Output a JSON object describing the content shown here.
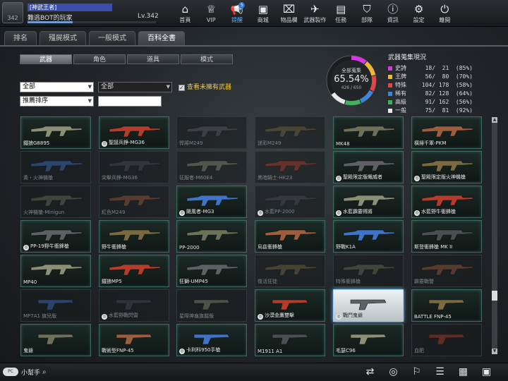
{
  "player": {
    "avatar_label": "342",
    "title": "[神武王者]",
    "nickname": "難逃BOT的玩家",
    "level": "Lv.342",
    "exp_fraction": 0.35
  },
  "nav": [
    {
      "label": "首頁",
      "icon": "home-icon",
      "glyph": "⌂"
    },
    {
      "label": "VIP",
      "icon": "vip-crown-icon",
      "glyph": "♕"
    },
    {
      "label": "提醒",
      "icon": "megaphone-icon",
      "glyph": "📢",
      "badge": "5"
    },
    {
      "label": "商城",
      "icon": "shop-icon",
      "glyph": "▣"
    },
    {
      "label": "物品欄",
      "icon": "backpack-icon",
      "glyph": "⌧"
    },
    {
      "label": "武器製作",
      "icon": "weapon-craft-icon",
      "glyph": "✈"
    },
    {
      "label": "任務",
      "icon": "ticket-icon",
      "glyph": "▤"
    },
    {
      "label": "部隊",
      "icon": "shield-icon",
      "glyph": "⛉"
    },
    {
      "label": "資訊",
      "icon": "info-icon",
      "glyph": "ⓘ"
    },
    {
      "label": "設定",
      "icon": "gear-icon",
      "glyph": "⚙"
    },
    {
      "label": "離開",
      "icon": "power-icon",
      "glyph": "⏻"
    }
  ],
  "tabs": [
    "排名",
    "殭屍模式",
    "一般模式",
    "百科全書"
  ],
  "active_tab": 3,
  "subtabs": [
    "武器",
    "角色",
    "道具",
    "模式"
  ],
  "active_subtab": 0,
  "filters": {
    "filter1": "全部",
    "filter2": "全部",
    "sort": "推薦排序",
    "show_unowned": "查看未擁有武器",
    "search_value": ""
  },
  "collection": {
    "label": "全部蒐集",
    "percent": "65.54%",
    "count": "426 / 650",
    "fraction": 0.6554,
    "stats_title": "武器蒐集現況",
    "rows": [
      {
        "name": "史詩",
        "value": "18/  21  (85%)",
        "color": "#d23adf"
      },
      {
        "name": "王牌",
        "value": "56/  80  (70%)",
        "color": "#f0b63a"
      },
      {
        "name": "特殊",
        "value": "104/ 178  (58%)",
        "color": "#e24545"
      },
      {
        "name": "稀有",
        "value": "82/ 128  (64%)",
        "color": "#3f86d8"
      },
      {
        "name": "高級",
        "value": "91/ 162  (56%)",
        "color": "#3fb25a"
      },
      {
        "name": "一般",
        "value": "75/  81  (92%)",
        "color": "#e8e8e8"
      }
    ]
  },
  "weapons": [
    {
      "name": "鐵狼G8895",
      "owned": true,
      "mark": false
    },
    {
      "name": "聖誕兵錚-MG36",
      "owned": true,
      "mark": true
    },
    {
      "name": "悍將M249",
      "owned": false,
      "mark": false
    },
    {
      "name": "迷彩M249",
      "owned": false,
      "mark": false
    },
    {
      "name": "MK48",
      "owned": true,
      "mark": false
    },
    {
      "name": "橫掃千軍-PKM",
      "owned": true,
      "mark": false
    },
    {
      "name": "黃・火神機槍",
      "owned": false,
      "mark": false
    },
    {
      "name": "突擊兵錚-MG36",
      "owned": false,
      "mark": false
    },
    {
      "name": "征服者-M60E4",
      "owned": false,
      "mark": false
    },
    {
      "name": "黑暗騎士-HK23",
      "owned": false,
      "mark": false
    },
    {
      "name": "聖殿限定版飆威者",
      "owned": true,
      "mark": true
    },
    {
      "name": "聖殿限定版火神機槍",
      "owned": true,
      "mark": true
    },
    {
      "name": "火神機槍-Minigun",
      "owned": false,
      "mark": false
    },
    {
      "name": "紅色M249",
      "owned": false,
      "mark": false
    },
    {
      "name": "颶風者-MG3",
      "owned": true,
      "mark": true
    },
    {
      "name": "水藍PP-2000",
      "owned": false,
      "mark": true
    },
    {
      "name": "水藍霹靂得將",
      "owned": true,
      "mark": true
    },
    {
      "name": "水藍野牛衝鋒槍",
      "owned": true,
      "mark": true
    },
    {
      "name": "PP-19野牛衝鋒槍",
      "owned": true,
      "mark": true
    },
    {
      "name": "野牛衝鋒槍",
      "owned": true,
      "mark": false
    },
    {
      "name": "PP-2000",
      "owned": true,
      "mark": false
    },
    {
      "name": "烏茲衝鋒槍",
      "owned": true,
      "mark": false
    },
    {
      "name": "野戰K1A",
      "owned": true,
      "mark": false
    },
    {
      "name": "斯登衝鋒槍 MK II",
      "owned": true,
      "mark": false
    },
    {
      "name": "MP40",
      "owned": true,
      "mark": false
    },
    {
      "name": "鐵狼MP5",
      "owned": true,
      "mark": false
    },
    {
      "name": "狂獅-UMP45",
      "owned": true,
      "mark": false
    },
    {
      "name": "復活狂徒",
      "owned": false,
      "mark": false
    },
    {
      "name": "特殊衝鋒槍",
      "owned": false,
      "mark": false
    },
    {
      "name": "霹靂戰警",
      "owned": false,
      "mark": false
    },
    {
      "name": "MP7A1 旗兒版",
      "owned": false,
      "mark": false
    },
    {
      "name": "水藍野戰閃雷",
      "owned": false,
      "mark": true
    },
    {
      "name": "星際神龜旗握版",
      "owned": false,
      "mark": false
    },
    {
      "name": "沙漠金鷹雙擊",
      "owned": true,
      "mark": true
    },
    {
      "name": "戰鬥鬼爺",
      "owned": true,
      "mark": true
    },
    {
      "name": "BATTLE FNP-45",
      "owned": true,
      "mark": false
    },
    {
      "name": "鬼爺",
      "owned": true,
      "mark": false
    },
    {
      "name": "戰術型FNP-45",
      "owned": true,
      "mark": false
    },
    {
      "name": "卡利科950手槍",
      "owned": true,
      "mark": true
    },
    {
      "name": "M1911 A1",
      "owned": true,
      "mark": false
    },
    {
      "name": "毛瑟C96",
      "owned": true,
      "mark": false
    },
    {
      "name": "血肥",
      "owned": false,
      "mark": false
    }
  ],
  "selected_weapon": 34,
  "bottom": {
    "chat_pill": "PC",
    "helper": "小幫手",
    "icons": [
      "swap-icon",
      "compass-icon",
      "runner-icon",
      "checklist-icon",
      "calendar-icon",
      "gallery-icon"
    ]
  }
}
